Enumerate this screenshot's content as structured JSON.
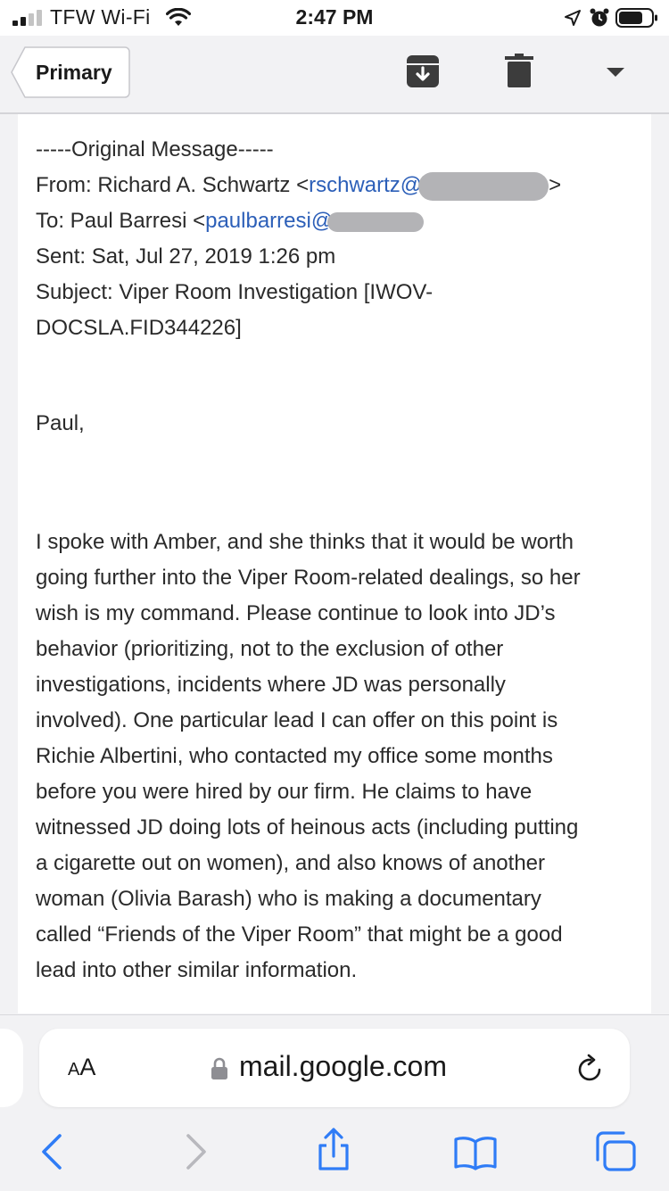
{
  "status_bar": {
    "carrier": "TFW Wi-Fi",
    "time": "2:47 PM"
  },
  "toolbar": {
    "back_label": "Primary",
    "icons": [
      "archive-icon",
      "trash-icon",
      "more-chevron-icon"
    ]
  },
  "message": {
    "original_header": "-----Original Message-----",
    "from_label": "From: Richard A. Schwartz <",
    "from_email": "rschwartz@",
    "from_close": ">",
    "to_label": "To: Paul Barresi <",
    "to_email": "paulbarresi@",
    "sent": "Sent: Sat, Jul 27, 2019 1:26 pm",
    "subject_line1": "Subject: Viper Room Investigation [IWOV-",
    "subject_line2": "DOCSLA.FID344226]",
    "greeting": "Paul,",
    "body_lines": [
      "I spoke with Amber, and she thinks that it would be worth",
      "going further into the Viper Room-related dealings, so her",
      "wish is my command. Please continue to look into JD’s",
      "behavior (prioritizing, not to the exclusion of other",
      "investigations, incidents where JD was personally",
      "involved).  One particular lead I can offer on this point is",
      "Richie Albertini, who contacted my office some months",
      "before you were hired by our firm.  He claims to have",
      "witnessed JD doing lots of heinous acts (including putting",
      "a cigarette out on women), and also knows of another",
      "woman (Olivia Barash) who is making a documentary",
      "called “Friends of the Viper Room” that might be a good",
      "lead into other similar information."
    ]
  },
  "safari": {
    "text_size_label_big": "A",
    "text_size_label_small": "A",
    "domain": "mail.google.com"
  },
  "colors": {
    "link": "#2c5fb8",
    "safari_accent": "#2f7cf6"
  }
}
